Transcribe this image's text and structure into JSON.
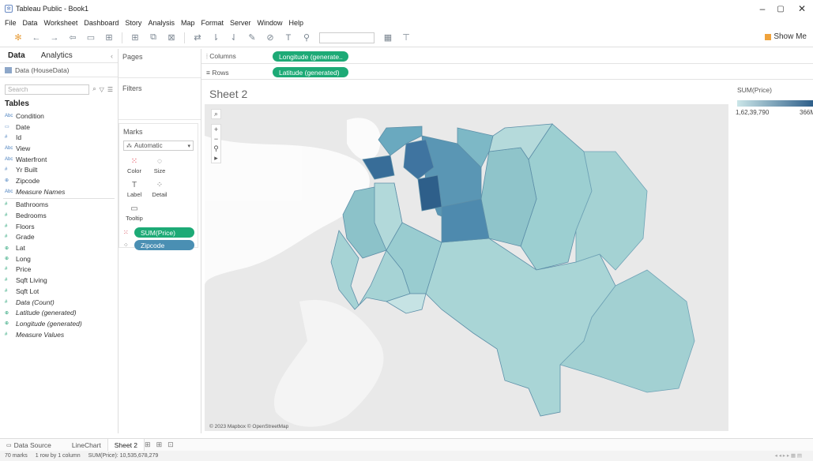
{
  "window": {
    "title": "Tableau Public - Book1",
    "minimize": "–",
    "maximize": "▢",
    "close": "✕"
  },
  "menu": [
    "File",
    "Data",
    "Worksheet",
    "Dashboard",
    "Story",
    "Analysis",
    "Map",
    "Format",
    "Server",
    "Window",
    "Help"
  ],
  "toolbar": {
    "show_me": "Show Me"
  },
  "left_panel": {
    "tabs": [
      "Data",
      "Analytics"
    ],
    "datasource": "Data (HouseData)",
    "search_placeholder": "Search",
    "tables_heading": "Tables",
    "fields": [
      {
        "icon": "Abc",
        "name": "Condition",
        "kind": "dimension"
      },
      {
        "icon": "▭",
        "name": "Date",
        "kind": "dimension"
      },
      {
        "icon": "#",
        "name": "Id",
        "kind": "dimension"
      },
      {
        "icon": "Abc",
        "name": "View",
        "kind": "dimension"
      },
      {
        "icon": "Abc",
        "name": "Waterfront",
        "kind": "dimension"
      },
      {
        "icon": "#",
        "name": "Yr Built",
        "kind": "dimension"
      },
      {
        "icon": "⊕",
        "name": "Zipcode",
        "kind": "dimension"
      },
      {
        "icon": "Abc",
        "name": "Measure Names",
        "kind": "dimension",
        "italic": true
      },
      {
        "icon": "#",
        "name": "Bathrooms",
        "kind": "measure"
      },
      {
        "icon": "#",
        "name": "Bedrooms",
        "kind": "measure"
      },
      {
        "icon": "#",
        "name": "Floors",
        "kind": "measure"
      },
      {
        "icon": "#",
        "name": "Grade",
        "kind": "measure"
      },
      {
        "icon": "⊕",
        "name": "Lat",
        "kind": "measure"
      },
      {
        "icon": "⊕",
        "name": "Long",
        "kind": "measure"
      },
      {
        "icon": "#",
        "name": "Price",
        "kind": "measure"
      },
      {
        "icon": "#",
        "name": "Sqft Living",
        "kind": "measure"
      },
      {
        "icon": "#",
        "name": "Sqft Lot",
        "kind": "measure"
      },
      {
        "icon": "#",
        "name": "Data (Count)",
        "kind": "measure",
        "italic": true
      },
      {
        "icon": "⊕",
        "name": "Latitude (generated)",
        "kind": "measure",
        "italic": true
      },
      {
        "icon": "⊕",
        "name": "Longitude (generated)",
        "kind": "measure",
        "italic": true
      },
      {
        "icon": "#",
        "name": "Measure Values",
        "kind": "measure",
        "italic": true
      }
    ]
  },
  "cards": {
    "pages": "Pages",
    "filters": "Filters",
    "marks": "Marks",
    "mark_type": "Automatic",
    "mark_buttons": [
      {
        "label": "Color",
        "icon": "⁙"
      },
      {
        "label": "Size",
        "icon": "◌"
      },
      {
        "label": "Label",
        "icon": "T"
      },
      {
        "label": "Detail",
        "icon": "⁘"
      },
      {
        "label": "Tooltip",
        "icon": "▭"
      }
    ],
    "mark_pills": [
      {
        "label": "SUM(Price)",
        "color": "#1daa76"
      },
      {
        "label": "Zipcode",
        "color": "#4a8fb3"
      }
    ]
  },
  "shelves": {
    "columns_label": "Columns",
    "columns_pill": "Longitude (generate..",
    "rows_label": "Rows",
    "rows_pill": "Latitude (generated)"
  },
  "view": {
    "sheet_title": "Sheet 2",
    "copyright": "© 2023 Mapbox © OpenStreetMap",
    "map_colors": {
      "land": "#e9e9e9",
      "water": "#ffffff",
      "low": "#a9d5d6",
      "high": "#2e5f8a"
    }
  },
  "legend": {
    "title": "SUM(Price)",
    "min": "1,62,39,790",
    "max": "366M"
  },
  "sheet_tabs": {
    "data_source": "Data Source",
    "tabs": [
      "LineChart",
      "Sheet 2"
    ],
    "active": "Sheet 2"
  },
  "status": {
    "marks": "70 marks",
    "rows_cols": "1 row by 1 column",
    "sum": "SUM(Price): 10,535,678,279"
  }
}
